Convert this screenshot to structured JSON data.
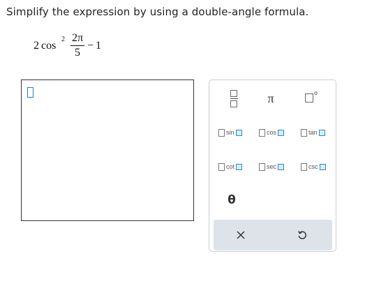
{
  "instruction": "Simplify the expression by using a double-angle formula.",
  "expression": {
    "coefficient": "2",
    "function": "cos",
    "exponent": "2",
    "numerator": "2π",
    "denominator": "5",
    "minus": "−",
    "constant": "1"
  },
  "palette": {
    "pi_label": "π",
    "degree_symbol": "o",
    "theta_label": "θ",
    "trig_functions": [
      "sin",
      "cos",
      "tan",
      "cot",
      "sec",
      "csc"
    ],
    "icons": {
      "fraction": "fraction-template-icon",
      "degree": "degree-template-icon",
      "close": "close-icon",
      "undo": "undo-icon"
    }
  },
  "colors": {
    "accent": "#2a8ac7",
    "bottom_bar": "#dde3e8"
  }
}
